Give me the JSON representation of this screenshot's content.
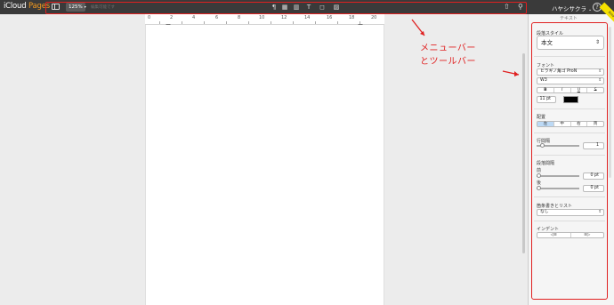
{
  "app": {
    "brand_main": "iCloud",
    "brand_accent": "Pages",
    "accent_color": "#f39a1e"
  },
  "toolbar": {
    "zoom": "125%",
    "zoom_caret": "▾",
    "ghost_text": "編集可能です",
    "tools": [
      "paragraph-icon",
      "table-icon",
      "chart-icon",
      "text-icon",
      "shape-icon",
      "image-icon"
    ],
    "tool_glyphs": [
      "¶",
      "▦",
      "▥",
      "T",
      "◻",
      "▨"
    ],
    "share_glyph": "⇧",
    "wrench_glyph": "⚲",
    "user": "ハヤシサクラ",
    "user_caret": "⌄",
    "help": "?"
  },
  "ruler": {
    "numbers": [
      "0",
      "2",
      "4",
      "6",
      "8",
      "10",
      "12",
      "14",
      "16",
      "18",
      "20"
    ]
  },
  "annotation": {
    "line1": "メニューバー",
    "line2": "とツールバー",
    "color": "#e02020"
  },
  "inspector": {
    "title": "テキスト",
    "tag": "Beta",
    "paragraph_style_label": "段落スタイル",
    "paragraph_style_value": "本文",
    "font_label": "フォント",
    "font_family": "ヒラギノ角ゴ ProN",
    "font_weight": "W3",
    "style_buttons": [
      "B",
      "I",
      "U",
      "S"
    ],
    "font_size": "11 pt",
    "text_color": "#000000",
    "alignment_label": "配置",
    "alignment_buttons": [
      "左",
      "中",
      "右",
      "両"
    ],
    "line_spacing_label": "行間隔",
    "line_spacing_value": "1",
    "paragraph_spacing_label": "段落間隔",
    "before_label": "前",
    "before_value": "0 pt",
    "after_label": "後",
    "after_value": "0 pt",
    "bullets_label": "箇条書きとリスト",
    "bullets_value": "なし",
    "indent_label": "インデント",
    "indent_buttons": [
      "◁≡",
      "≡▷"
    ],
    "dropdown_arrow": "⇕"
  }
}
